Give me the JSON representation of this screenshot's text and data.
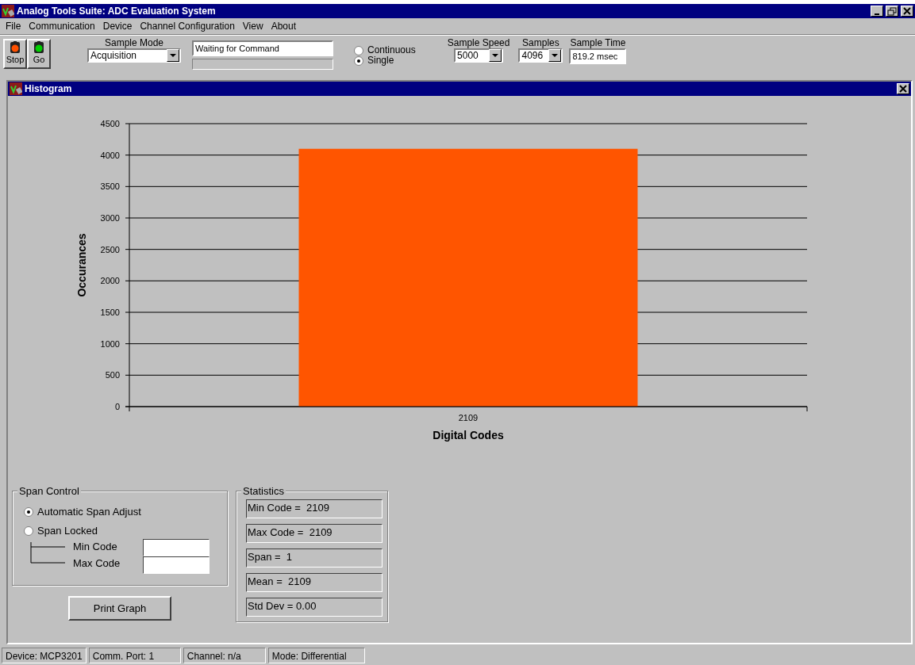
{
  "window": {
    "title": "Analog Tools Suite: ADC Evaluation System"
  },
  "menu": [
    "File",
    "Communication",
    "Device",
    "Channel Configuration",
    "View",
    "About"
  ],
  "toolbar": {
    "buttons": [
      {
        "label": "Stop",
        "kind": "stop"
      },
      {
        "label": "Go",
        "kind": "go"
      }
    ],
    "sample_mode": {
      "label": "Sample Mode",
      "value": "Acquisition"
    },
    "status_field": {
      "value": "Waiting for Command"
    },
    "progress": {
      "level": 0
    },
    "modes": [
      {
        "label": "Continuous",
        "selected": false
      },
      {
        "label": "Single",
        "selected": true
      }
    ],
    "dropdowns": [
      {
        "label": "Sample Speed",
        "value": "5000"
      },
      {
        "label": "Samples",
        "value": "4096"
      }
    ],
    "sample_time": {
      "label": "Sample Time",
      "value": "819.2 msec"
    }
  },
  "histogram": {
    "title": "Histogram",
    "chart_data": {
      "type": "bar",
      "xlabel": "Digital Codes",
      "ylabel": "Occurances",
      "categories": [
        "2109"
      ],
      "series": [
        {
          "color": "#ff5500",
          "values": [
            4100
          ]
        }
      ],
      "grid": true,
      "ylim": [
        0,
        4500
      ],
      "yticks": [
        0,
        500,
        1000,
        1500,
        2000,
        2500,
        3000,
        3500,
        4000,
        4500
      ]
    },
    "span_control": {
      "title": "Span Control",
      "options": [
        {
          "label": "Automatic Span Adjust",
          "selected": true
        },
        {
          "label": "Span Locked",
          "selected": false
        }
      ],
      "fields": [
        {
          "label": "Min Code"
        },
        {
          "label": "Max Code"
        }
      ]
    },
    "print_button": "Print Graph",
    "statistics": {
      "title": "Statistics",
      "items": [
        "Min Code =  2109",
        "Max Code =  2109",
        "Span =  1",
        "Mean =  2109",
        "Std Dev = 0.00"
      ]
    }
  },
  "status_bar": [
    "Device: MCP3201",
    "Comm. Port: 1",
    "Channel: n/a",
    "Mode: Differential"
  ]
}
